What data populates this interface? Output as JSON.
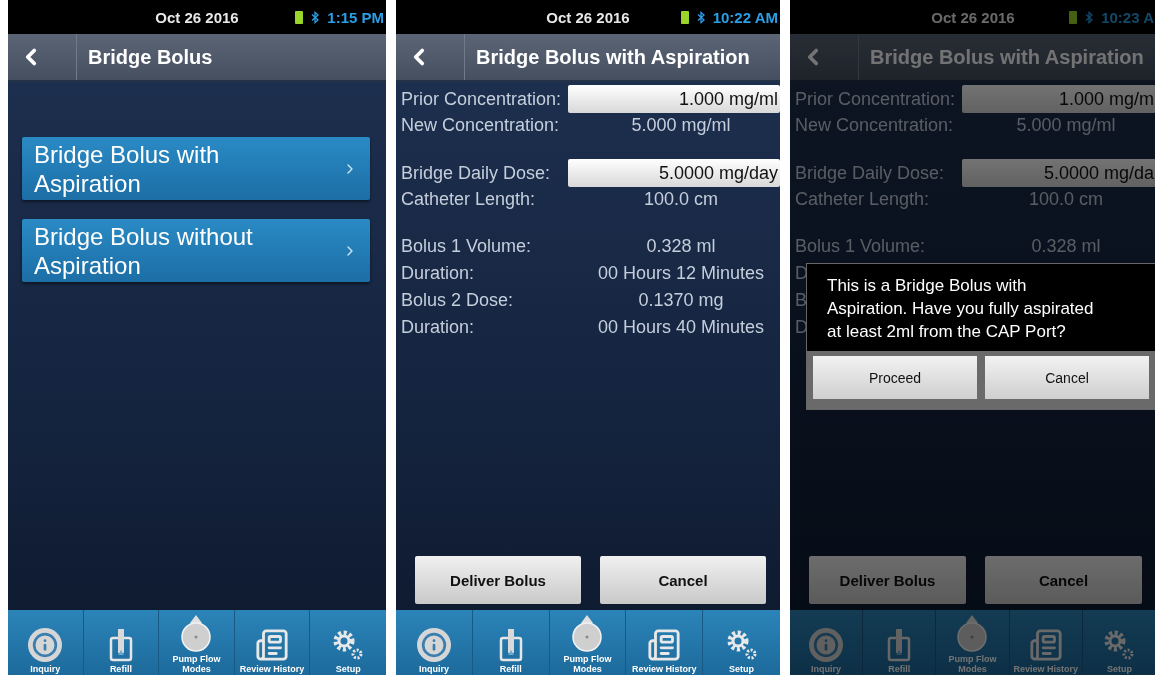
{
  "screens": [
    {
      "status": {
        "date": "Oct 26 2016",
        "time": "1:15 PM"
      },
      "header": {
        "title": "Bridge Bolus"
      },
      "menu_items": [
        {
          "label": "Bridge Bolus with Aspiration"
        },
        {
          "label": "Bridge Bolus without Aspiration"
        }
      ],
      "nav": [
        {
          "kind": "info",
          "label": "Inquiry"
        },
        {
          "kind": "refill",
          "label": "Refill"
        },
        {
          "kind": "pump",
          "label": "Pump Flow Modes"
        },
        {
          "kind": "history",
          "label": "Review History"
        },
        {
          "kind": "setup",
          "label": "Setup"
        }
      ]
    },
    {
      "status": {
        "date": "Oct 26 2016",
        "time": "10:22 AM"
      },
      "header": {
        "title": "Bridge Bolus with Aspiration"
      },
      "groups": [
        [
          {
            "kind": "input",
            "label": "Prior Concentration:",
            "value": "1.000 mg/ml"
          },
          {
            "kind": "readout",
            "label": "New Concentration:",
            "value": "5.000 mg/ml"
          }
        ],
        [
          {
            "kind": "input",
            "label": "Bridge Daily Dose:",
            "value": "5.0000 mg/day"
          },
          {
            "kind": "readout",
            "label": "Catheter Length:",
            "value": "100.0 cm"
          }
        ],
        [
          {
            "kind": "readout",
            "label": "Bolus 1 Volume:",
            "value": "0.328 ml"
          },
          {
            "kind": "readout",
            "label": "Duration:",
            "value": "00 Hours 12 Minutes"
          },
          {
            "kind": "readout",
            "label": "Bolus 2 Dose:",
            "value": "0.1370 mg"
          },
          {
            "kind": "readout",
            "label": "Duration:",
            "value": "00 Hours 40 Minutes"
          }
        ]
      ],
      "actions": [
        "Deliver Bolus",
        "Cancel"
      ],
      "nav": [
        {
          "kind": "info",
          "label": "Inquiry"
        },
        {
          "kind": "refill",
          "label": "Refill"
        },
        {
          "kind": "pump",
          "label": "Pump Flow Modes"
        },
        {
          "kind": "history",
          "label": "Review History"
        },
        {
          "kind": "setup",
          "label": "Setup"
        }
      ]
    },
    {
      "status": {
        "date": "Oct 26 2016",
        "time": "10:23 A"
      },
      "header": {
        "title": "Bridge Bolus with Aspiration"
      },
      "dimmed": true,
      "groups": [
        [
          {
            "kind": "input",
            "label": "Prior Concentration:",
            "value": "1.000 mg/m"
          },
          {
            "kind": "readout",
            "label": "New Concentration:",
            "value": "5.000 mg/ml"
          }
        ],
        [
          {
            "kind": "input",
            "label": "Bridge Daily Dose:",
            "value": "5.0000 mg/da"
          },
          {
            "kind": "readout",
            "label": "Catheter Length:",
            "value": "100.0 cm"
          }
        ],
        [
          {
            "kind": "readout",
            "label": "Bolus 1 Volume:",
            "value": "0.328 ml"
          },
          {
            "kind": "covered",
            "label": "D"
          },
          {
            "kind": "covered",
            "label": "B"
          },
          {
            "kind": "covered",
            "label": "D"
          }
        ]
      ],
      "actions": [
        "Deliver Bolus",
        "Cancel"
      ],
      "dialog": {
        "message": "This is a Bridge Bolus with Aspiration. Have you fully aspirated at least 2ml from the CAP Port?",
        "buttons": [
          "Proceed",
          "Cancel"
        ]
      },
      "nav": [
        {
          "kind": "info",
          "label": "Inquiry"
        },
        {
          "kind": "refill",
          "label": "Refill"
        },
        {
          "kind": "pump",
          "label": "Pump Flow Modes"
        },
        {
          "kind": "history",
          "label": "Review History"
        },
        {
          "kind": "setup",
          "label": "Setup"
        }
      ]
    }
  ]
}
